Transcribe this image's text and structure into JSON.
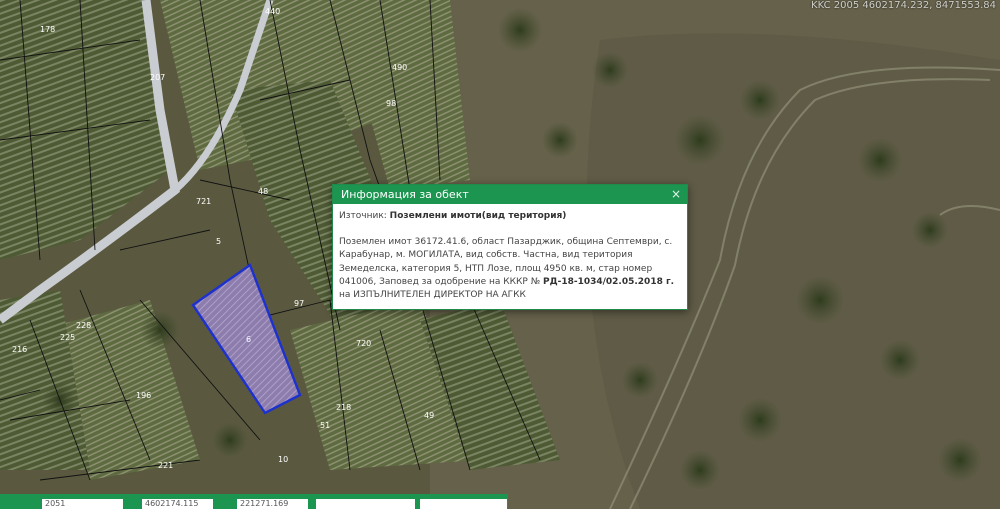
{
  "map": {
    "coords_readout": "KKC 2005 4602174.232, 8471553.84",
    "parcel_numbers": [
      "207",
      "440",
      "490",
      "721",
      "5",
      "6",
      "97",
      "98",
      "720",
      "218",
      "216",
      "225",
      "228",
      "196",
      "221",
      "178",
      "51",
      "49",
      "10",
      "48"
    ],
    "colors": {
      "parcel_outline": "#1a2fd6",
      "parcel_fill": "#9c88c4",
      "cadastre_lines": "#111111",
      "road": "#c9ccd0"
    }
  },
  "popup": {
    "title": "Информация за обект",
    "close_symbol": "×",
    "source_label": "Източник:",
    "source_value": "Поземлени имоти(вид територия)",
    "description": "Поземлен имот 36172.41.6, област Пазарджик, община Септември, с. Карабунар, м. МОГИЛАТА, вид собств. Частна, вид територия Земеделска, категория 5, НТП Лозе, площ 4950 кв. м, стар номер 041006, Заповед за одобрение на КККР №",
    "order_number": "РД-18-1034/02.05.2018 г.",
    "description_end": "на ИЗПЪЛНИТЕЛЕН ДИРЕКТОР НА АГКК",
    "accent_color": "#1c9550"
  },
  "statusbar": {
    "scale_value": "2051",
    "x_value": "4602174.115",
    "y_value": "221271.169",
    "extra_value": ""
  }
}
